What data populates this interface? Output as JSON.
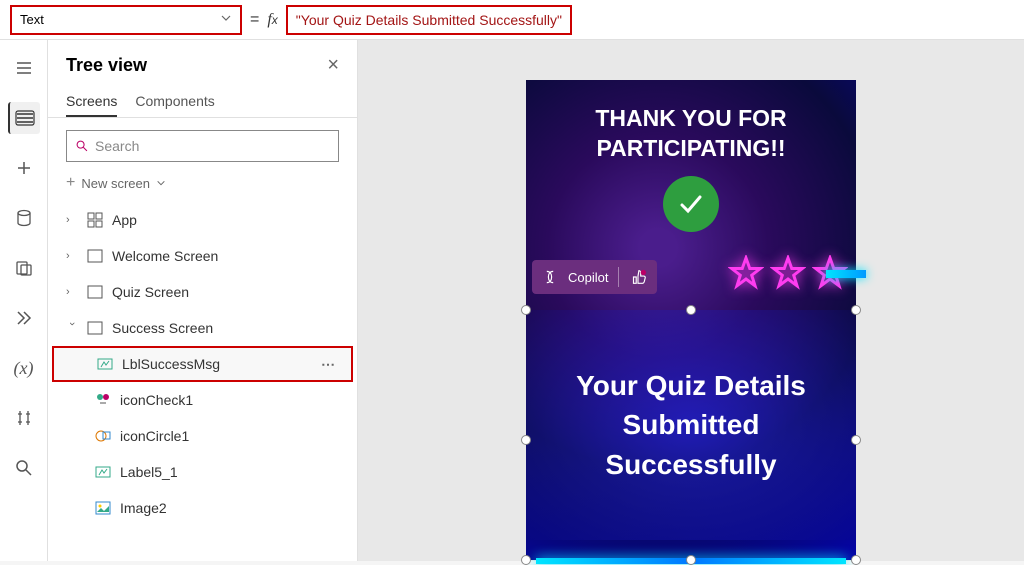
{
  "formula": {
    "property": "Text",
    "value": "\"Your Quiz Details Submitted Successfully\""
  },
  "treeview": {
    "title": "Tree view",
    "tabs": {
      "screens": "Screens",
      "components": "Components"
    },
    "search_placeholder": "Search",
    "new_screen": "New screen",
    "nodes": {
      "app": "App",
      "welcome": "Welcome Screen",
      "quiz": "Quiz Screen",
      "success": "Success Screen",
      "lbl": "LblSuccessMsg",
      "iconcheck": "iconCheck1",
      "iconcircle": "iconCircle1",
      "label5": "Label5_1",
      "image2": "Image2"
    }
  },
  "preview": {
    "thank_you_l1": "THANK YOU FOR",
    "thank_you_l2": "PARTICIPATING!!",
    "copilot": "Copilot",
    "success_l1": "Your Quiz Details",
    "success_l2": "Submitted",
    "success_l3": "Successfully"
  }
}
